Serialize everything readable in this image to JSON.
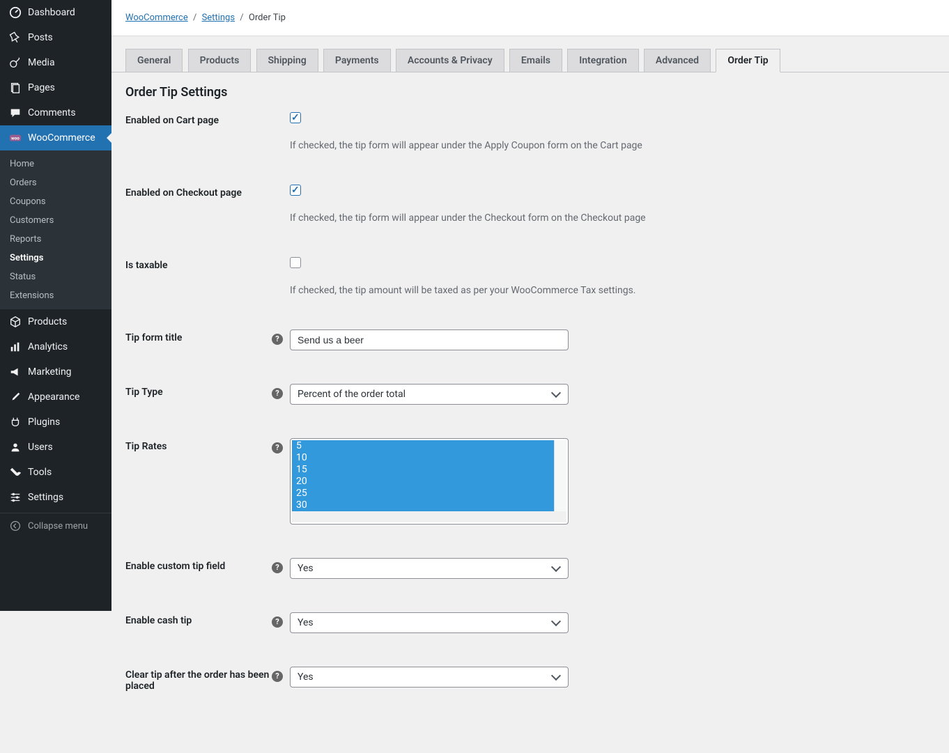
{
  "sidebar": {
    "items": [
      {
        "label": "Dashboard"
      },
      {
        "label": "Posts"
      },
      {
        "label": "Media"
      },
      {
        "label": "Pages"
      },
      {
        "label": "Comments"
      },
      {
        "label": "WooCommerce"
      },
      {
        "label": "Products"
      },
      {
        "label": "Analytics"
      },
      {
        "label": "Marketing"
      },
      {
        "label": "Appearance"
      },
      {
        "label": "Plugins"
      },
      {
        "label": "Users"
      },
      {
        "label": "Tools"
      },
      {
        "label": "Settings"
      }
    ],
    "submenu": [
      "Home",
      "Orders",
      "Coupons",
      "Customers",
      "Reports",
      "Settings",
      "Status",
      "Extensions"
    ],
    "collapse": "Collapse menu"
  },
  "breadcrumb": {
    "woocommerce": "WooCommerce",
    "settings": "Settings",
    "current": "Order Tip"
  },
  "tabs": [
    "General",
    "Products",
    "Shipping",
    "Payments",
    "Accounts & Privacy",
    "Emails",
    "Integration",
    "Advanced",
    "Order Tip"
  ],
  "page": {
    "title": "Order Tip Settings"
  },
  "fields": {
    "enabled_cart": {
      "label": "Enabled on Cart page",
      "desc": "If checked, the tip form will appear under the Apply Coupon form on the Cart page",
      "checked": true
    },
    "enabled_checkout": {
      "label": "Enabled on Checkout page",
      "desc": "If checked, the tip form will appear under the Checkout form on the Checkout page",
      "checked": true
    },
    "is_taxable": {
      "label": "Is taxable",
      "desc": "If checked, the tip amount will be taxed as per your WooCommerce Tax settings.",
      "checked": false
    },
    "tip_title": {
      "label": "Tip form title",
      "value": "Send us a beer"
    },
    "tip_type": {
      "label": "Tip Type",
      "value": "Percent of the order total"
    },
    "tip_rates": {
      "label": "Tip Rates",
      "options": [
        "5",
        "10",
        "15",
        "20",
        "25",
        "30"
      ]
    },
    "enable_custom": {
      "label": "Enable custom tip field",
      "value": "Yes"
    },
    "enable_cash": {
      "label": "Enable cash tip",
      "value": "Yes"
    },
    "clear_tip": {
      "label": "Clear tip after the order has been placed",
      "value": "Yes"
    }
  }
}
